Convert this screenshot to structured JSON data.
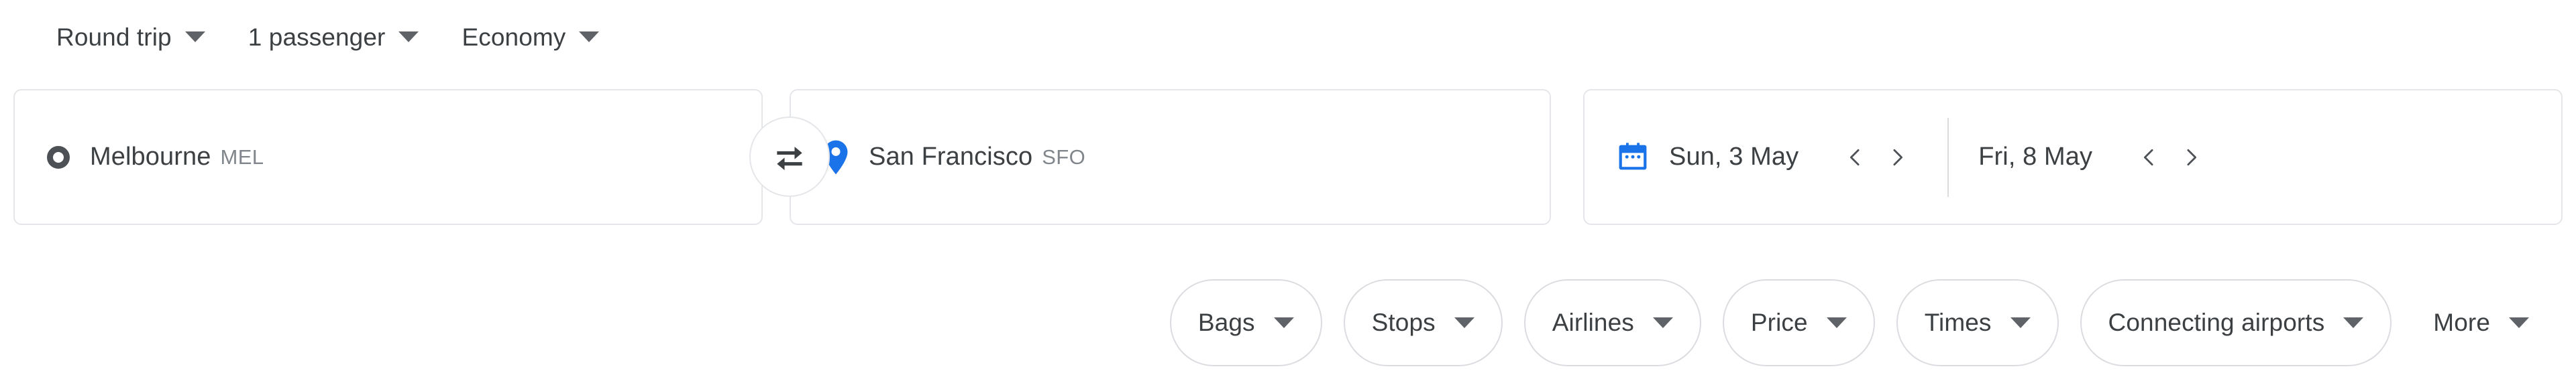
{
  "trip_options": [
    {
      "label": "Round trip",
      "name": "trip-type-dropdown"
    },
    {
      "label": "1 passenger",
      "name": "passenger-count-dropdown"
    },
    {
      "label": "Economy",
      "name": "cabin-class-dropdown"
    }
  ],
  "search": {
    "origin": {
      "city": "Melbourne",
      "code": "MEL",
      "icon": "circle-outline-icon"
    },
    "swap": {
      "icon": "swap-horizontal-icon"
    },
    "destination": {
      "city": "San Francisco",
      "code": "SFO",
      "icon": "location-pin-icon"
    },
    "dates": {
      "icon": "calendar-icon",
      "departure": {
        "value": "Sun, 3 May",
        "prev": "‹",
        "next": "›"
      },
      "return": {
        "value": "Fri, 8 May",
        "prev": "‹",
        "next": "›"
      }
    }
  },
  "filters": [
    {
      "label": "Bags",
      "name": "filter-bags",
      "bordered": true
    },
    {
      "label": "Stops",
      "name": "filter-stops",
      "bordered": true
    },
    {
      "label": "Airlines",
      "name": "filter-airlines",
      "bordered": true
    },
    {
      "label": "Price",
      "name": "filter-price",
      "bordered": true
    },
    {
      "label": "Times",
      "name": "filter-times",
      "bordered": true
    },
    {
      "label": "Connecting airports",
      "name": "filter-connecting-airports",
      "bordered": true
    },
    {
      "label": "More",
      "name": "filter-more",
      "bordered": false
    }
  ],
  "colors": {
    "accent_blue": "#1a73e8",
    "text_primary": "#3c4043",
    "text_secondary": "#80868b",
    "border": "#dadce0"
  }
}
